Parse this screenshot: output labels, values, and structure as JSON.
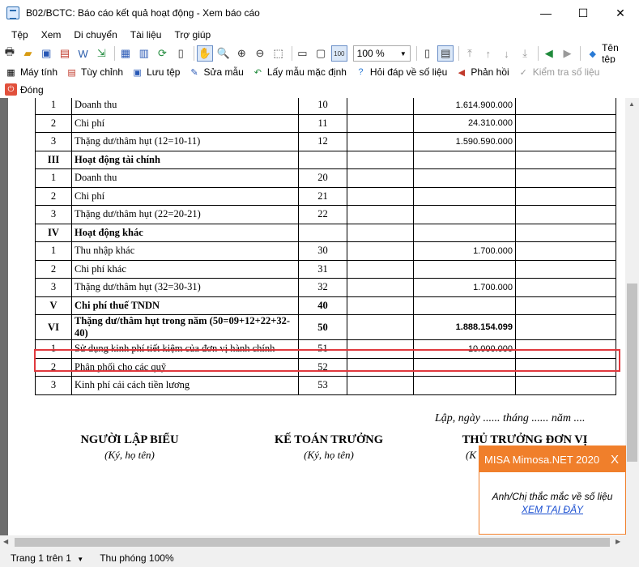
{
  "window": {
    "title": "B02/BCTC: Báo cáo kết quả hoạt động - Xem báo cáo",
    "controls": {
      "minimize": "—",
      "maximize": "☐",
      "close": "✕"
    }
  },
  "menu": [
    "Tệp",
    "Xem",
    "Di chuyển",
    "Tài liệu",
    "Trợ giúp"
  ],
  "toolbar": {
    "zoom_value": "100 %",
    "file_name_label": "Tên tệp",
    "calculator_label": "Máy tính",
    "customize_label": "Tùy chỉnh",
    "save_template_label": "Lưu tệp",
    "edit_template_label": "Sửa mẫu",
    "default_template_label": "Lấy mẫu mặc định",
    "qa_label": "Hỏi đáp về số liệu",
    "feedback_label": "Phản hồi",
    "check_data_label": "Kiểm tra số liệu",
    "close_label": "Đóng"
  },
  "table": {
    "rows": [
      {
        "stt": "1",
        "name": "Doanh thu",
        "code": "10",
        "note": "",
        "current": "1.614.900.000",
        "previous": ""
      },
      {
        "stt": "2",
        "name": "Chi phí",
        "code": "11",
        "note": "",
        "current": "24.310.000",
        "previous": ""
      },
      {
        "stt": "3",
        "name": "Thặng dư/thâm hụt (12=10-11)",
        "code": "12",
        "note": "",
        "current": "1.590.590.000",
        "previous": ""
      },
      {
        "stt": "III",
        "name": "Hoạt động tài chính",
        "code": "",
        "note": "",
        "current": "",
        "previous": ""
      },
      {
        "stt": "1",
        "name": "Doanh thu",
        "code": "20",
        "note": "",
        "current": "",
        "previous": ""
      },
      {
        "stt": "2",
        "name": "Chi phí",
        "code": "21",
        "note": "",
        "current": "",
        "previous": ""
      },
      {
        "stt": "3",
        "name": "Thặng dư/thâm hụt (22=20-21)",
        "code": "22",
        "note": "",
        "current": "",
        "previous": ""
      },
      {
        "stt": "IV",
        "name": "Hoạt động khác",
        "code": "",
        "note": "",
        "current": "",
        "previous": ""
      },
      {
        "stt": "1",
        "name": "Thu nhập khác",
        "code": "30",
        "note": "",
        "current": "1.700.000",
        "previous": ""
      },
      {
        "stt": "2",
        "name": "Chi phí khác",
        "code": "31",
        "note": "",
        "current": "",
        "previous": ""
      },
      {
        "stt": "3",
        "name": "Thặng dư/thâm hụt (32=30-31)",
        "code": "32",
        "note": "",
        "current": "1.700.000",
        "previous": ""
      },
      {
        "stt": "V",
        "name": "Chi phí thuế TNDN",
        "code": "40",
        "note": "",
        "current": "",
        "previous": ""
      },
      {
        "stt": "VI",
        "name": "Thặng dư/thâm hụt trong năm (50=09+12+22+32-40)",
        "code": "50",
        "note": "",
        "current": "1.888.154.099",
        "previous": ""
      },
      {
        "stt": "1",
        "name": "Sử dụng kinh phí tiết kiệm của đơn vị hành chính",
        "code": "51",
        "note": "",
        "current": "10.000.000",
        "previous": ""
      },
      {
        "stt": "2",
        "name": "Phân phối cho các quỹ",
        "code": "52",
        "note": "",
        "current": "",
        "previous": ""
      },
      {
        "stt": "3",
        "name": "Kinh phí cải cách tiền lương",
        "code": "53",
        "note": "",
        "current": "",
        "previous": ""
      }
    ]
  },
  "signature": {
    "date_line": "Lập, ngày ...... tháng ...... năm ....",
    "preparer_title": "NGƯỜI LẬP BIỂU",
    "preparer_sub": "(Ký, họ tên)",
    "accountant_title": "KẾ TOÁN TRƯỞNG",
    "accountant_sub": "(Ký, họ tên)",
    "head_title": "THỦ TRƯỞNG ĐƠN VỊ",
    "head_sub": "(K"
  },
  "status": {
    "page": "Trang 1 trên 1",
    "zoom": "Thu phóng 100%"
  },
  "popup": {
    "title": "MISA Mimosa.NET 2020",
    "close": "X",
    "message": "Anh/Chị thắc mắc về số liệu",
    "link": "XEM TẠI ĐÂY"
  }
}
